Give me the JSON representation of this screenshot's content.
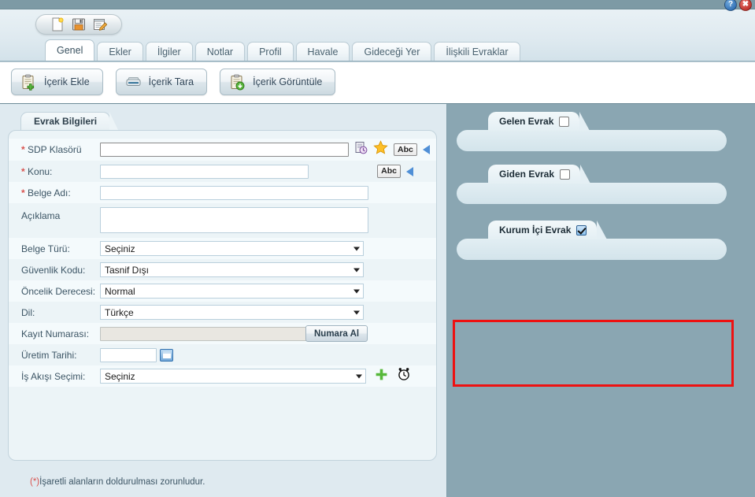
{
  "window": {
    "help_icon": "help-question-icon",
    "help_label": "?",
    "close_icon": "close-x-icon",
    "close_label": "✖"
  },
  "toolbar": {
    "icons": [
      {
        "name": "new-document-icon",
        "title": "Yeni"
      },
      {
        "name": "save-icon",
        "title": "Kaydet"
      },
      {
        "name": "edit-icon",
        "title": "Düzenle"
      }
    ]
  },
  "tabs": [
    {
      "label": "Genel",
      "active": true
    },
    {
      "label": "Ekler",
      "active": false
    },
    {
      "label": "İlgiler",
      "active": false
    },
    {
      "label": "Notlar",
      "active": false
    },
    {
      "label": "Profil",
      "active": false
    },
    {
      "label": "Havale",
      "active": false
    },
    {
      "label": "Gideceği Yer",
      "active": false
    },
    {
      "label": "İlişkili Evraklar",
      "active": false
    }
  ],
  "actions": [
    {
      "label": "İçerik Ekle",
      "icon": "clipboard-plus-icon"
    },
    {
      "label": "İçerik Tara",
      "icon": "scanner-icon"
    },
    {
      "label": "İçerik Görüntüle",
      "icon": "clipboard-download-icon"
    }
  ],
  "form": {
    "panel_tab": "Evrak Bilgileri",
    "fields": {
      "sdp_klasoru": {
        "label": "SDP Klasörü",
        "required": true,
        "value": "",
        "history_icon": "document-history-icon",
        "favorite_icon": "star-icon",
        "abc_label": "Abc",
        "expand_icon": "blue-triangle-icon"
      },
      "konu": {
        "label": "Konu:",
        "required": true,
        "value": "",
        "abc_label": "Abc",
        "expand_icon": "blue-triangle-icon"
      },
      "belge_adi": {
        "label": "Belge Adı:",
        "required": true,
        "value": ""
      },
      "aciklama": {
        "label": "Açıklama",
        "required": false,
        "value": ""
      },
      "belge_turu": {
        "label": "Belge Türü:",
        "value": "Seçiniz"
      },
      "guvenlik_kodu": {
        "label": "Güvenlik Kodu:",
        "value": "Tasnif Dışı"
      },
      "oncelik_derecesi": {
        "label": "Öncelik Derecesi:",
        "value": "Normal"
      },
      "dil": {
        "label": "Dil:",
        "value": "Türkçe"
      },
      "kayit_numarasi": {
        "label": "Kayıt Numarası:",
        "value": "",
        "button_label": "Numara Al"
      },
      "uretim_tarihi": {
        "label": "Üretim Tarihi:",
        "value": "",
        "calendar_icon": "calendar-icon"
      },
      "is_akisi_secimi": {
        "label": "İş Akışı Seçimi:",
        "value": "Seçiniz",
        "add_icon": "green-plus-icon",
        "clock_icon": "alarm-clock-icon"
      }
    },
    "footnote": "(*)İşaretli alanların doldurulması zorunludur.",
    "footnote_marker": "(*)"
  },
  "evrak_groups": [
    {
      "label": "Gelen Evrak",
      "checked": false,
      "highlighted": false
    },
    {
      "label": "Giden Evrak",
      "checked": false,
      "highlighted": false
    },
    {
      "label": "Kurum İçi Evrak",
      "checked": true,
      "highlighted": true
    }
  ],
  "colors": {
    "window_bg": "#8aa6b2",
    "panel_bg": "#ecf4f7",
    "accent": "#4f8fd6",
    "required_star": "#d9534f",
    "highlight_box": "#ee1111"
  }
}
